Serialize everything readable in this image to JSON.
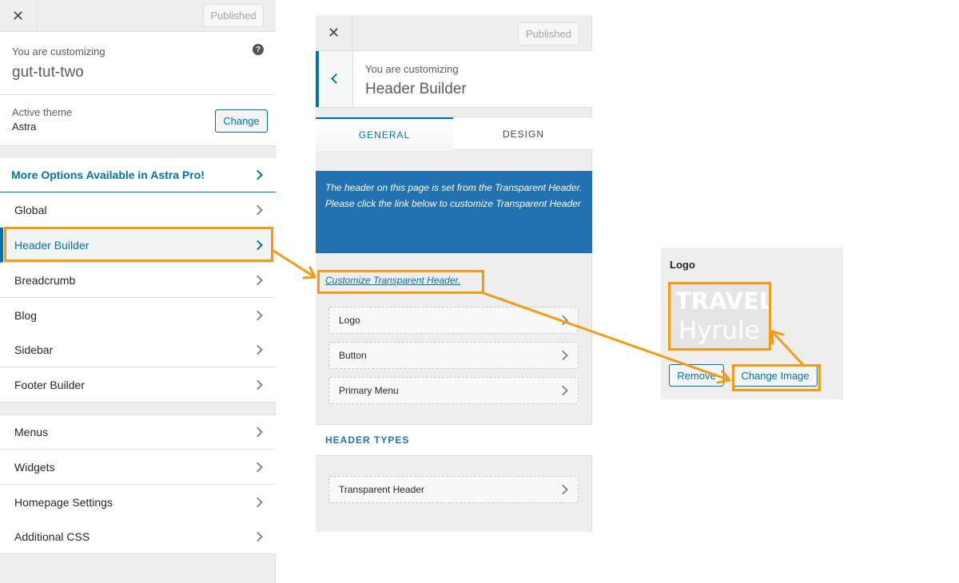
{
  "left": {
    "close": "✕",
    "published": "Published",
    "customizing_label": "You are customizing",
    "site_name": "gut-tut-two",
    "help": "?",
    "active_theme_label": "Active theme",
    "active_theme_value": "Astra",
    "change_label": "Change",
    "pro_label": "More Options Available in Astra Pro!",
    "items": [
      "Global",
      "Header Builder",
      "Breadcrumb",
      "Blog",
      "Sidebar",
      "Footer Builder"
    ],
    "items2": [
      "Menus",
      "Widgets",
      "Homepage Settings",
      "Additional CSS"
    ]
  },
  "mid": {
    "close": "✕",
    "published": "Published",
    "customizing_label": "You are customizing",
    "section_name": "Header Builder",
    "tabs": [
      "GENERAL",
      "DESIGN"
    ],
    "notice_line1": "The header on this page is set from the Transparent Header.",
    "notice_line2": "Please click the link below to customize Transparent Header",
    "customize_link": "Customize Transparent Header.",
    "rows": [
      "Logo",
      "Button",
      "Primary Menu"
    ],
    "header_types_label": "HEADER TYPES",
    "transparent_row": "Transparent Header"
  },
  "right": {
    "label": "Logo",
    "logo_line1": "TRAVEL",
    "logo_line2": "Hyrule",
    "remove_label": "Remove",
    "change_image_label": "Change Image"
  },
  "colors": {
    "accent": "#0073aa",
    "notice_bg": "#2271b1",
    "annotation": "#f39c12"
  }
}
